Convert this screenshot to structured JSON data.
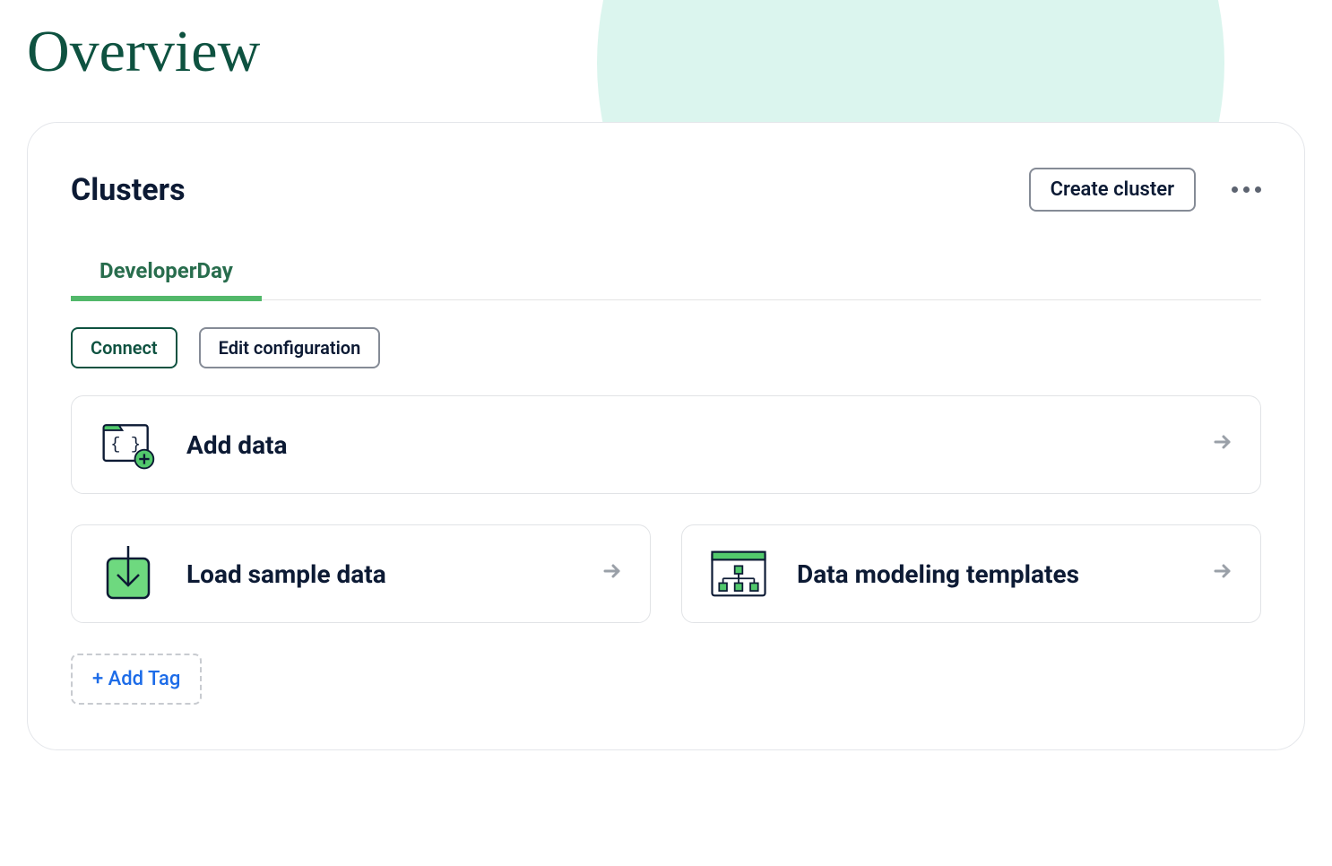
{
  "page_title": "Overview",
  "panel": {
    "heading": "Clusters",
    "create_button": "Create cluster"
  },
  "tabs": [
    {
      "label": "DeveloperDay",
      "active": true
    }
  ],
  "buttons": {
    "connect": "Connect",
    "edit_config": "Edit configuration"
  },
  "cards": {
    "add_data": "Add data",
    "load_sample": "Load sample data",
    "data_modeling": "Data modeling templates"
  },
  "add_tag": "+ Add Tag"
}
